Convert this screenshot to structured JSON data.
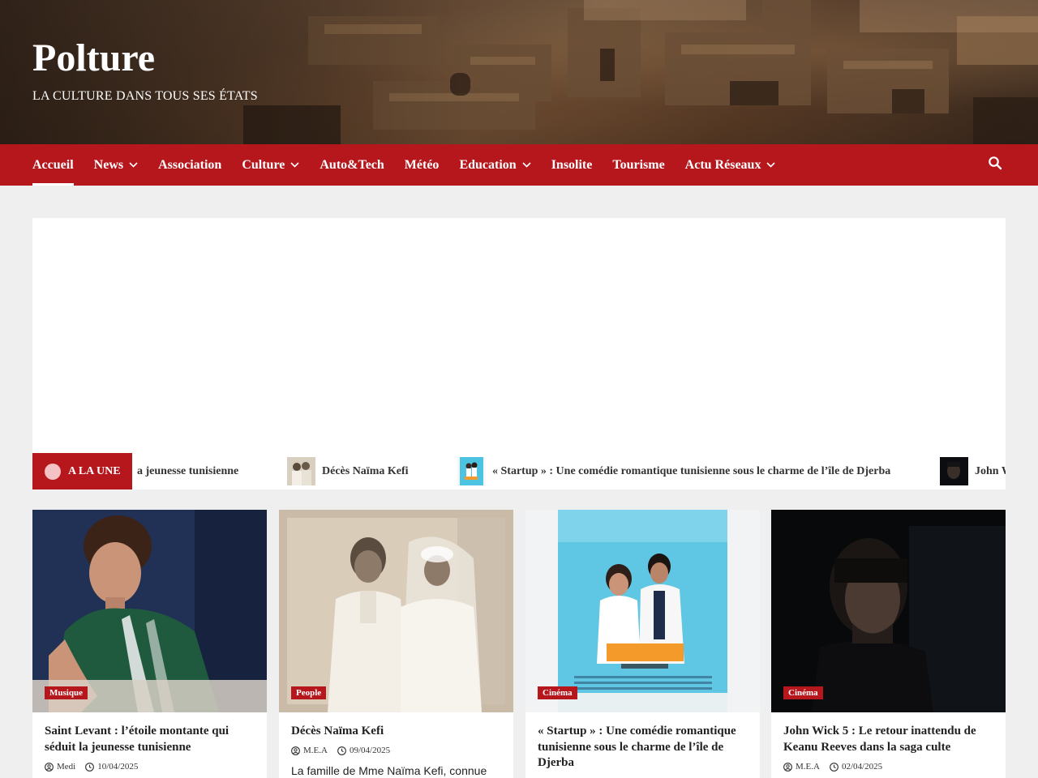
{
  "site": {
    "title": "Polture",
    "tagline": "LA CULTURE DANS TOUS SES ÉTATS"
  },
  "nav": {
    "items": [
      {
        "label": "Accueil",
        "dropdown": false,
        "active": true
      },
      {
        "label": "News",
        "dropdown": true
      },
      {
        "label": "Association",
        "dropdown": false
      },
      {
        "label": "Culture",
        "dropdown": true
      },
      {
        "label": "Auto&Tech",
        "dropdown": false
      },
      {
        "label": "Météo",
        "dropdown": false
      },
      {
        "label": "Education",
        "dropdown": true
      },
      {
        "label": "Insolite",
        "dropdown": false
      },
      {
        "label": "Tourisme",
        "dropdown": false
      },
      {
        "label": "Actu Réseaux",
        "dropdown": true
      }
    ],
    "search_icon": "search-icon"
  },
  "ticker": {
    "label": "A LA UNE",
    "items": [
      {
        "text": "a jeunesse tunisienne"
      },
      {
        "text": "Décès Naïma Kefi"
      },
      {
        "text": "« Startup » : Une comédie romantique tunisienne sous le charme de l’île de Djerba"
      },
      {
        "text": "John W"
      }
    ]
  },
  "cards": [
    {
      "category": "Musique",
      "title": "Saint Levant : l’étoile montante qui séduit la jeunesse tunisienne",
      "author": "Medi",
      "date": "10/04/2025",
      "excerpt": ""
    },
    {
      "category": "People",
      "title": "Décès Naïma Kefi",
      "author": "M.E.A",
      "date": "09/04/2025",
      "excerpt": "La famille de Mme Naïma Kefi, connue"
    },
    {
      "category": "Cinéma",
      "title": "« Startup » : Une comédie romantique tunisienne sous le charme de l’île de Djerba",
      "author": "",
      "date": "",
      "excerpt": ""
    },
    {
      "category": "Cinéma",
      "title": "John Wick 5 : Le retour inattendu de Keanu Reeves dans la saga culte",
      "author": "M.E.A",
      "date": "02/04/2025",
      "excerpt": ""
    }
  ],
  "colors": {
    "brand_red": "#b5171d",
    "nav_text": "#ffffff",
    "page_bg": "#efefef"
  }
}
